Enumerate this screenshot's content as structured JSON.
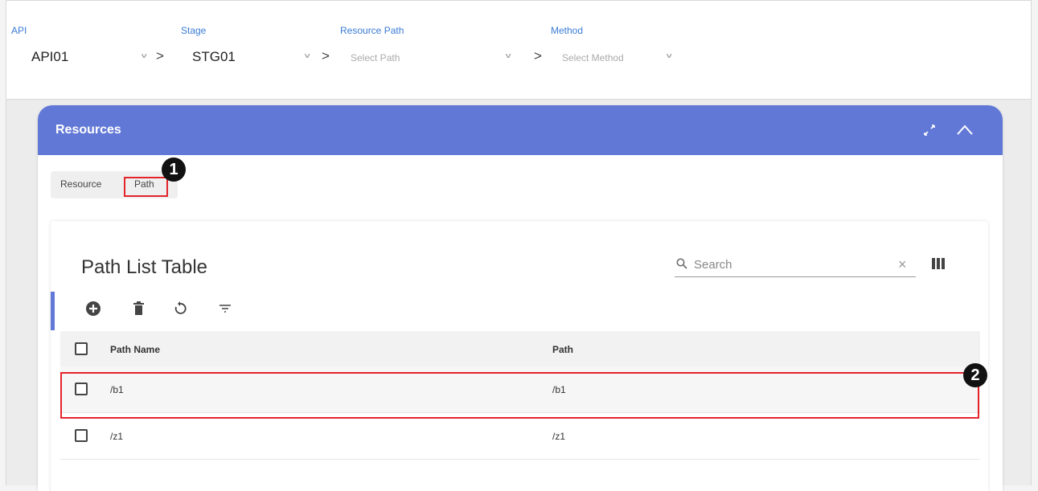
{
  "selectors": {
    "api": {
      "label": "API",
      "value": "API01"
    },
    "stage": {
      "label": "Stage",
      "value": "STG01"
    },
    "resource_path": {
      "label": "Resource Path",
      "placeholder": "Select Path"
    },
    "method": {
      "label": "Method",
      "placeholder": "Select Method"
    }
  },
  "card": {
    "title": "Resources",
    "tabs": [
      "Resource",
      "Path"
    ]
  },
  "table": {
    "title": "Path List Table",
    "search_placeholder": "Search",
    "columns": [
      "Path Name",
      "Path"
    ],
    "rows": [
      {
        "name": "/b1",
        "path": "/b1"
      },
      {
        "name": "/z1",
        "path": "/z1"
      }
    ]
  },
  "annotations": [
    "1",
    "2"
  ],
  "colors": {
    "accent": "#6278d6",
    "highlight": "#e3242b",
    "label_blue": "#3a7bd5"
  },
  "icons": [
    "chevron-down-icon",
    "chevron-right-icon",
    "expand-icon",
    "collapse-icon",
    "search-icon",
    "clear-icon",
    "columns-icon",
    "add-icon",
    "delete-icon",
    "refresh-icon",
    "filter-icon"
  ]
}
